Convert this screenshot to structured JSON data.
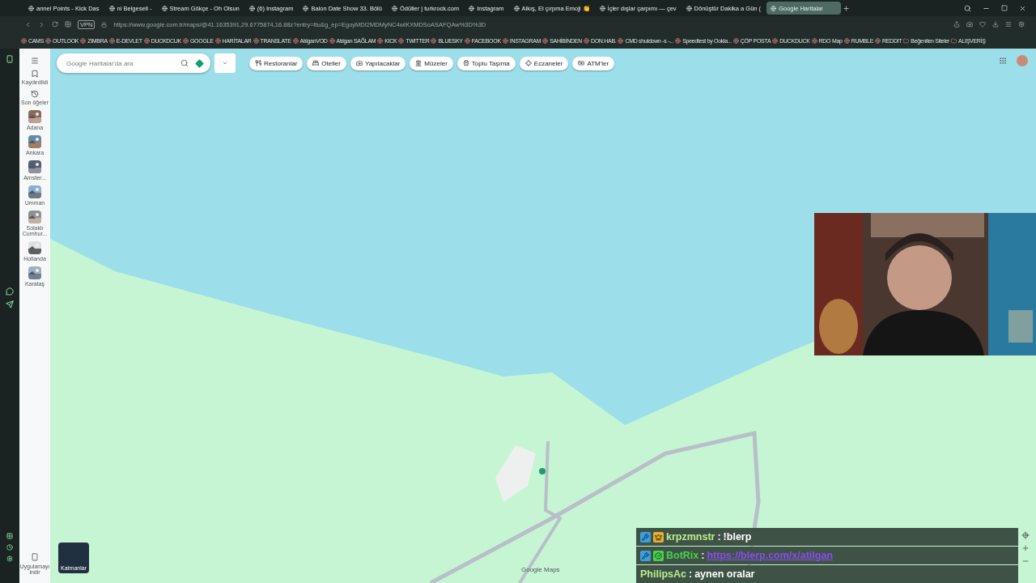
{
  "browser": {
    "tabs": [
      {
        "title": "annel Points - Kick Das",
        "selected": false
      },
      {
        "title": "ni Belgeseli -",
        "selected": false
      },
      {
        "title": "Stream Gökçe - Oh Olsun",
        "selected": false
      },
      {
        "title": "(6) Instagram",
        "selected": false
      },
      {
        "title": "Balon Date Show 33. Bölü",
        "selected": false
      },
      {
        "title": "Ödüller | turkrock.com",
        "selected": false
      },
      {
        "title": "Instagram",
        "selected": false
      },
      {
        "title": "Alkış, El çırpma Emoji 👏",
        "selected": false
      },
      {
        "title": "İçler dışlar çarpımı — çev",
        "selected": false
      },
      {
        "title": "Dönüştür Dakika a Gün (",
        "selected": false
      },
      {
        "title": "Google Haritalar",
        "selected": true
      }
    ],
    "vpn_label": "VPN",
    "url": "https://www.google.com.tr/maps/@41.1635391,29.6775874,16.88z?entry=ttu&g_ep=EgoyMDI2MDMyNC4wIKXMDSoASAFQAw%3D%3D",
    "bookmarks": [
      {
        "label": "CAMS",
        "kind": "link"
      },
      {
        "label": "OUTLOOK",
        "kind": "link"
      },
      {
        "label": "ZIMBRA",
        "kind": "link"
      },
      {
        "label": "E-DEVLET",
        "kind": "link"
      },
      {
        "label": "DUCKDCUK",
        "kind": "link"
      },
      {
        "label": "GOOGLE",
        "kind": "link"
      },
      {
        "label": "HARİTALAR",
        "kind": "link"
      },
      {
        "label": "TRANSLATE",
        "kind": "link"
      },
      {
        "label": "AtılganVOD",
        "kind": "link"
      },
      {
        "label": "Atılgan SAĞLAM",
        "kind": "link"
      },
      {
        "label": "KICK",
        "kind": "link"
      },
      {
        "label": "TWITTER",
        "kind": "link"
      },
      {
        "label": "BLUESKY",
        "kind": "link"
      },
      {
        "label": "FACEBOOK",
        "kind": "link"
      },
      {
        "label": "INSTAGRAM",
        "kind": "link"
      },
      {
        "label": "SAHİBİNDEN",
        "kind": "link"
      },
      {
        "label": "DON.HAB.",
        "kind": "link"
      },
      {
        "label": "CMD shutdown -s -...",
        "kind": "link"
      },
      {
        "label": "Speedtest by Ookla...",
        "kind": "link"
      },
      {
        "label": "ÇÖP POSTA",
        "kind": "link"
      },
      {
        "label": "DUCKDUCK",
        "kind": "link"
      },
      {
        "label": "RDO Map",
        "kind": "link"
      },
      {
        "label": "RUMBLE",
        "kind": "link"
      },
      {
        "label": "REDDIT",
        "kind": "link"
      },
      {
        "label": "Beğenilen Siteler",
        "kind": "folder"
      },
      {
        "label": "ALIŞVERİŞ",
        "kind": "folder"
      }
    ]
  },
  "maps": {
    "search": {
      "placeholder": "Google Haritalar'da ara"
    },
    "chips": [
      "Restoranlar",
      "Oteller",
      "Yapılacaklar",
      "Müzeler",
      "Toplu Taşıma",
      "Eczaneler",
      "ATM'ler"
    ],
    "rail": [
      {
        "label": "Kaydedildi",
        "kind": "saved"
      },
      {
        "label": "Son öğeler",
        "kind": "recent"
      }
    ],
    "places": [
      "Adana",
      "Ankara",
      "Amster...",
      "Umman",
      "Solaklı Cumhur...",
      "Hollanda",
      "Karataş"
    ],
    "app_download": "Uygulamayı indir",
    "layers": "Katmanlar",
    "wordmark": "Google Maps"
  },
  "chat": [
    {
      "user": "krpzmnstr",
      "separator": ":",
      "color": "#b8f08c",
      "badges": [
        {
          "kind": "mod"
        },
        {
          "kind": "crown"
        }
      ],
      "message": "!blerp",
      "link": false
    },
    {
      "user": "BotRix",
      "separator": ":",
      "color": "#46d44a",
      "badges": [
        {
          "kind": "mod"
        },
        {
          "kind": "verified"
        }
      ],
      "message": "https://blerp.com/x/atilgan",
      "link": true
    },
    {
      "user": "PhilipsAc",
      "separator": ":",
      "color": "#b8f08c",
      "message": "aynen oralar",
      "link": false
    }
  ]
}
